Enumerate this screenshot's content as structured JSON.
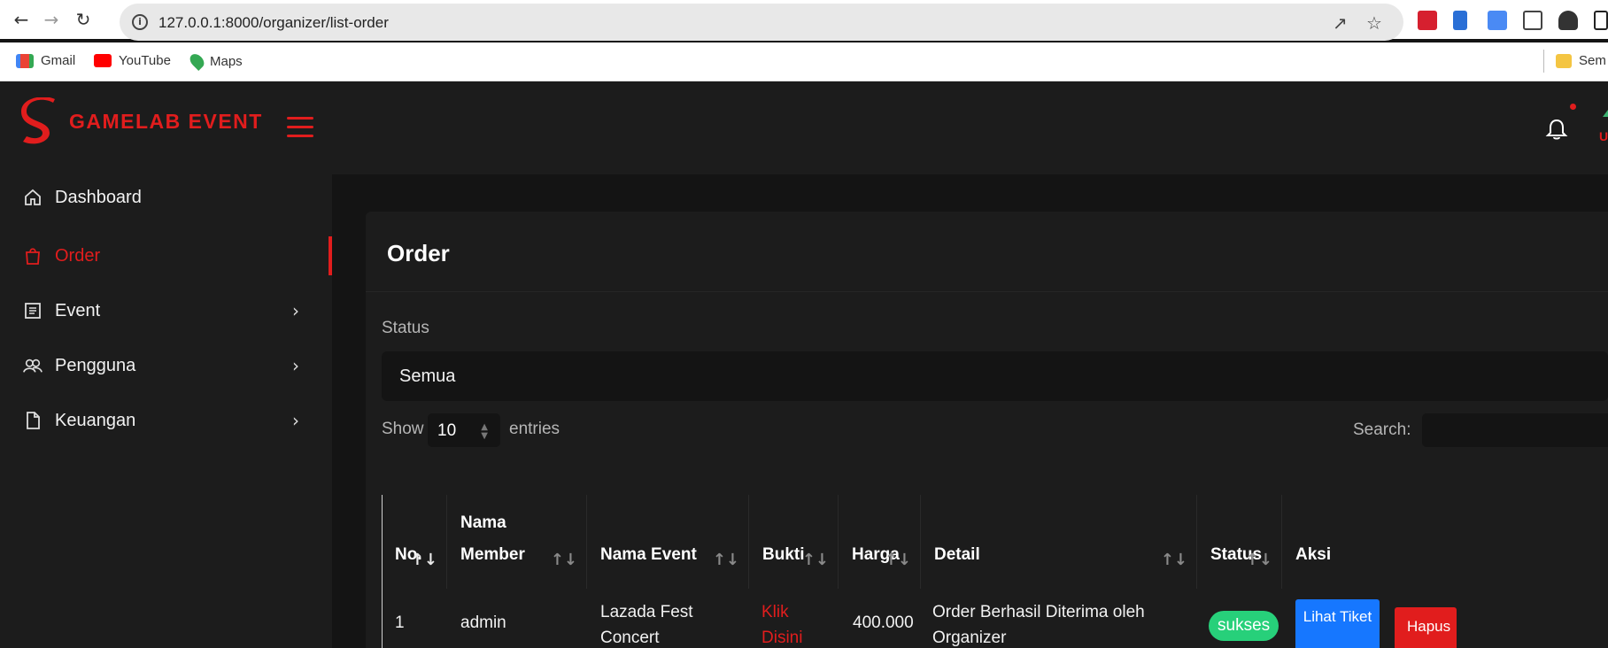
{
  "browser": {
    "url": "127.0.0.1:8000/organizer/list-order",
    "bookmarks": [
      {
        "label": "Gmail",
        "icon": "gmail-icon"
      },
      {
        "label": "YouTube",
        "icon": "youtube-icon"
      },
      {
        "label": "Maps",
        "icon": "maps-icon"
      }
    ],
    "bookmark_folder": "Sem"
  },
  "header": {
    "brand": "GAMELAB EVENT",
    "avatar_initial": "U"
  },
  "sidebar": {
    "items": [
      {
        "label": "Dashboard",
        "icon": "home-icon"
      },
      {
        "label": "Order",
        "icon": "bag-icon",
        "active": true
      },
      {
        "label": "Event",
        "icon": "list-icon",
        "expandable": true
      },
      {
        "label": "Pengguna",
        "icon": "users-icon",
        "expandable": true
      },
      {
        "label": "Keuangan",
        "icon": "file-icon",
        "expandable": true
      }
    ]
  },
  "page": {
    "title": "Order",
    "status_label": "Status",
    "status_value": "Semua",
    "show_label": "Show",
    "entries_value": "10",
    "entries_label": "entries",
    "search_label": "Search:"
  },
  "table": {
    "headers": [
      {
        "label": "No.",
        "sort": "asc"
      },
      {
        "label": "Nama\nMember",
        "sort": "none"
      },
      {
        "label": "Nama Event",
        "sort": "none"
      },
      {
        "label": "Bukti",
        "sort": "none"
      },
      {
        "label": "Harga",
        "sort": "none"
      },
      {
        "label": "Detail",
        "sort": "none"
      },
      {
        "label": "Status",
        "sort": "none"
      },
      {
        "label": "Aksi",
        "sort": "none"
      }
    ],
    "rows": [
      {
        "no": "1",
        "member": "admin",
        "event": "Lazada Fest Concert",
        "bukti": "Klik Disini",
        "harga": "400.000",
        "detail": "Order Berhasil Diterima oleh Organizer",
        "status": "sukses",
        "action_view": "Lihat Tiket",
        "action_delete": "Hapus"
      }
    ]
  },
  "colors": {
    "accent": "#e11d1d",
    "success": "#27d07a",
    "primary": "#1677ff",
    "background": "#141414",
    "panel": "#1c1c1c"
  }
}
